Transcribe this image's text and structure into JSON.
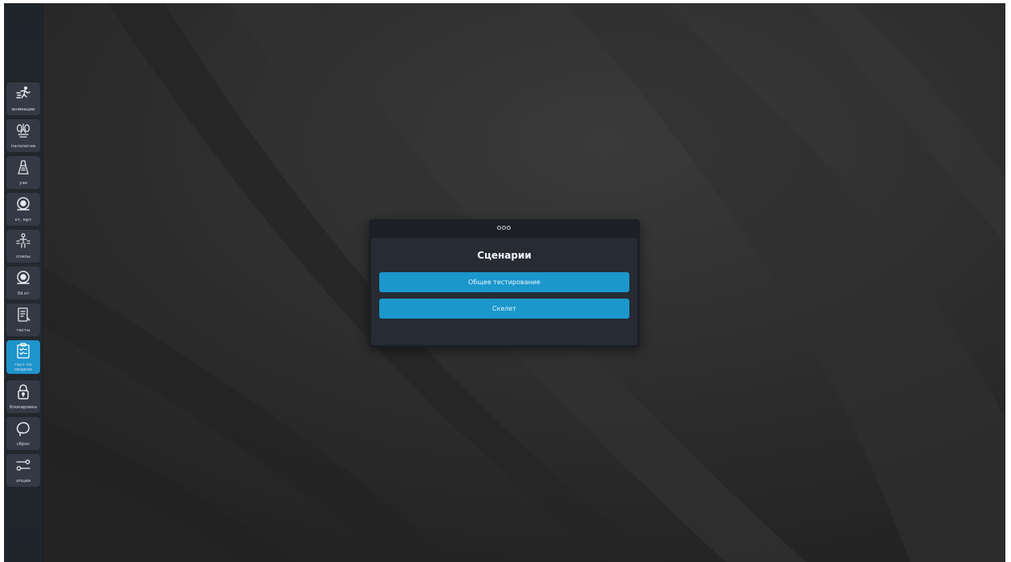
{
  "sidebar": {
    "items": [
      {
        "label": "анимации",
        "icon": "running-person-icon"
      },
      {
        "label": "патология",
        "icon": "organs-icon"
      },
      {
        "label": "узи",
        "icon": "ultrasound-probe-icon"
      },
      {
        "label": "кт, мрт",
        "icon": "ct-scanner-icon"
      },
      {
        "label": "спилы",
        "icon": "body-slices-icon"
      },
      {
        "label": "3d кт",
        "icon": "ct-3d-icon"
      },
      {
        "label": "тесты",
        "icon": "test-book-icon"
      },
      {
        "label": "тест по модели",
        "icon": "clipboard-check-icon",
        "active": true
      },
      {
        "label": "блокировка",
        "icon": "lock-icon"
      },
      {
        "label": "сброс",
        "icon": "reset-icon"
      },
      {
        "label": "опции",
        "icon": "sliders-icon"
      }
    ]
  },
  "dialog": {
    "title": "Сценарии",
    "buttons": [
      {
        "label": "Общее тестирование"
      },
      {
        "label": "Скелет"
      }
    ]
  },
  "colors": {
    "accent": "#1b97cc",
    "sidebar_button": "#343a45",
    "background": "#2b2b2b"
  }
}
